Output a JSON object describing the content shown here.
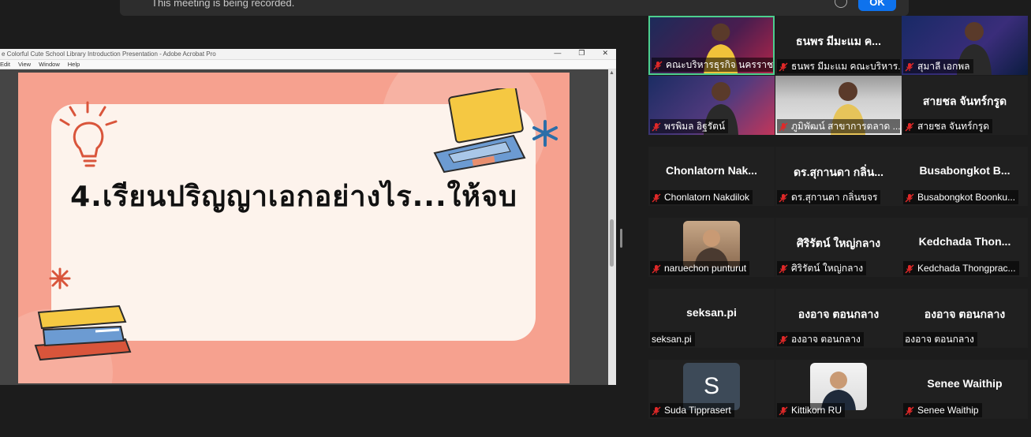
{
  "recording_banner": {
    "message": "This meeting is being recorded.",
    "ok_label": "OK"
  },
  "shared_window": {
    "title": "e Colorful Cute School Library Introduction Presentation - Adobe Acrobat Pro",
    "menu": [
      "Edit",
      "View",
      "Window",
      "Help"
    ]
  },
  "slide": {
    "title": "4.เรียนปริญญาเอกอย่างไร...ให้จบ"
  },
  "participants": [
    {
      "display": "video",
      "label": "คณะบริหารธุรกิจ นครราชสีมา",
      "muted": true,
      "active": true
    },
    {
      "display": "name",
      "big_name": "ธนพร มีมะแม ค...",
      "label": "ธนพร มีมะแม คณะบริหาร...",
      "muted": true
    },
    {
      "display": "video",
      "label": "สุมาลี เอกพล",
      "muted": true
    },
    {
      "display": "video",
      "label": "พรพิมล อิฐรัตน์",
      "muted": true
    },
    {
      "display": "video",
      "label": "ภูมิพัฒน์ สาขาการตลาด ...",
      "muted": true
    },
    {
      "display": "name",
      "big_name": "สายชล จันทร์กรูด",
      "label": "สายชล จันทร์กรูด",
      "muted": true
    },
    {
      "display": "name",
      "big_name": "Chonlatorn  Nak...",
      "label": "Chonlatorn Nakdilok",
      "muted": true
    },
    {
      "display": "name",
      "big_name": "ดร.สุกานดา กลิ่น...",
      "label": "ดร.สุกานดา กลิ่นขจร",
      "muted": true
    },
    {
      "display": "name",
      "big_name": "Busabongkot  B...",
      "label": "Busabongkot Boonku...",
      "muted": true
    },
    {
      "display": "photo",
      "label": "naruechon punturut",
      "muted": true
    },
    {
      "display": "name",
      "big_name": "ศิริรัตน์  ใหญ่กลาง",
      "label": "ศิริรัตน์  ใหญ่กลาง",
      "muted": true
    },
    {
      "display": "name",
      "big_name": "Kedchada  Thon...",
      "label": "Kedchada Thongprac...",
      "muted": true
    },
    {
      "display": "name",
      "big_name": "seksan.pi",
      "label": "seksan.pi",
      "muted": false
    },
    {
      "display": "name",
      "big_name": "องอาจ ตอนกลาง",
      "label": "องอาจ ตอนกลาง",
      "muted": true
    },
    {
      "display": "name",
      "big_name": "องอาจ ตอนกลาง",
      "label": "องอาจ ตอนกลาง",
      "muted": false
    },
    {
      "display": "initial",
      "initial": "S",
      "label": "Suda Tipprasert",
      "muted": true
    },
    {
      "display": "photo",
      "label": "Kittikorn RU",
      "muted": true
    },
    {
      "display": "name",
      "big_name": "Senee Waithip",
      "label": "Senee Waithip",
      "muted": true
    }
  ],
  "colors": {
    "slide_bg": "#f6a18f",
    "card_bg": "#fdf3ec",
    "active_speaker": "#4ccf8f",
    "muted_icon": "#e02828",
    "ok_button": "#0e72ed"
  }
}
